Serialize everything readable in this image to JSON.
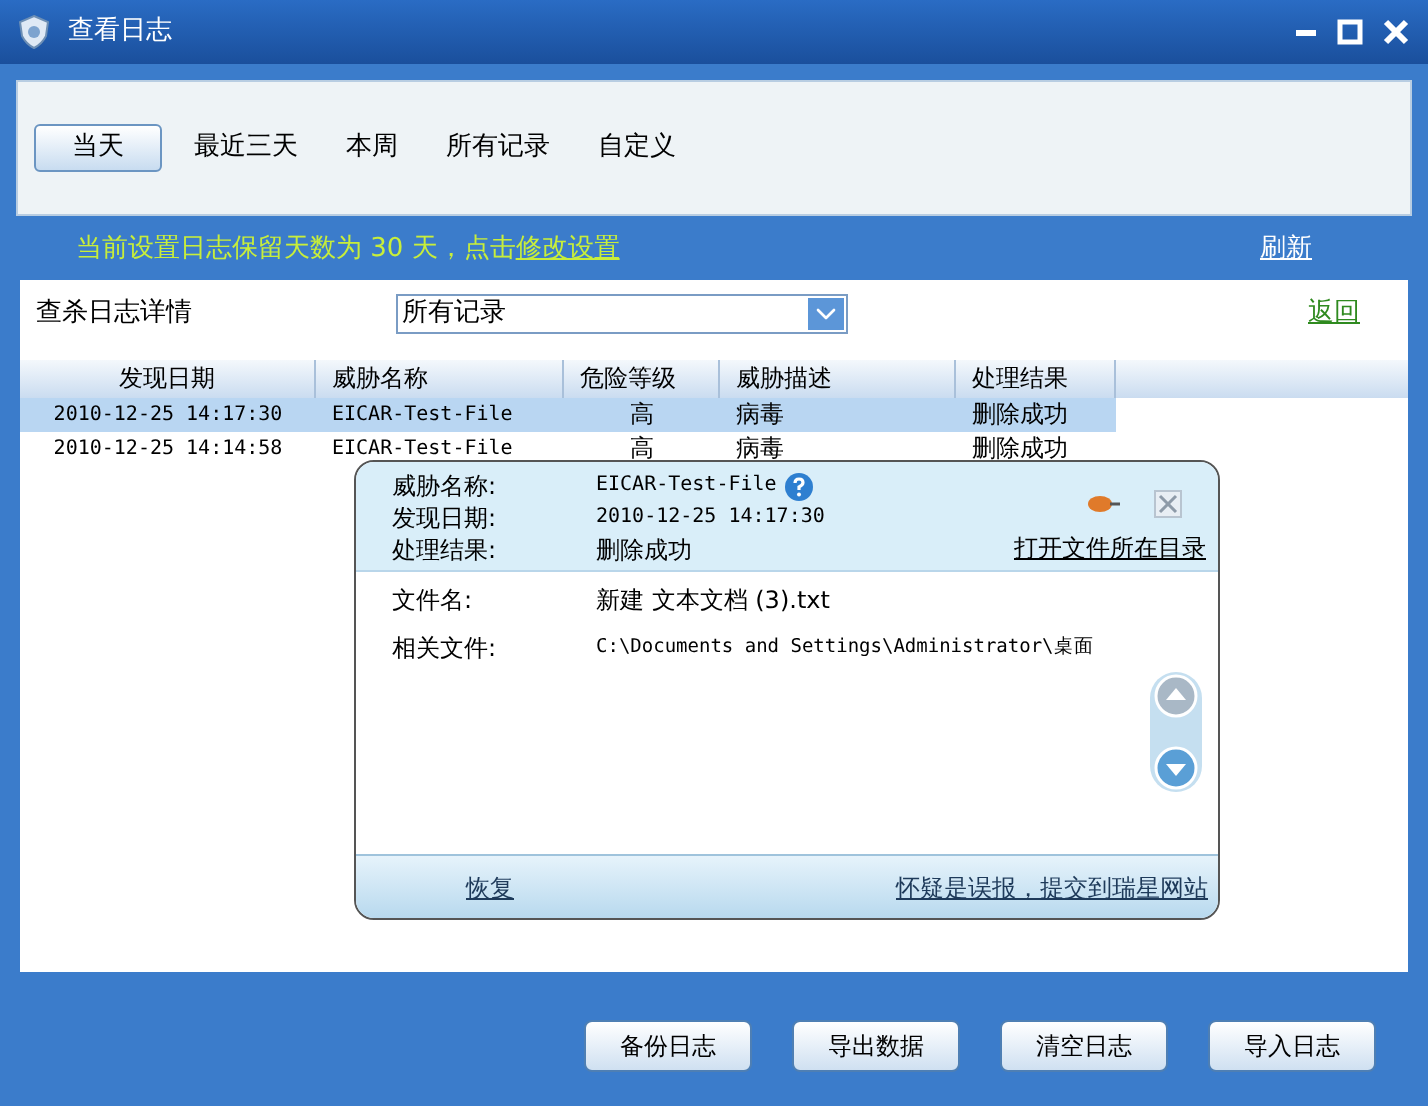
{
  "window": {
    "title": "查看日志"
  },
  "tabs": [
    {
      "label": "当天",
      "selected": true
    },
    {
      "label": "最近三天",
      "selected": false
    },
    {
      "label": "本周",
      "selected": false
    },
    {
      "label": "所有记录",
      "selected": false
    },
    {
      "label": "自定义",
      "selected": false
    }
  ],
  "notice": {
    "text": "当前设置日志保留天数为 30 天，点击",
    "link": "修改设置"
  },
  "refresh": "刷新",
  "filter": {
    "label": "查杀日志详情",
    "value": "所有记录"
  },
  "back": "返回",
  "table": {
    "columns": [
      "发现日期",
      "威胁名称",
      "危险等级",
      "威胁描述",
      "处理结果"
    ],
    "rows": [
      {
        "cells": [
          "2010-12-25 14:17:30",
          "EICAR-Test-File",
          "高",
          "病毒",
          "删除成功"
        ],
        "selected": true
      },
      {
        "cells": [
          "2010-12-25 14:14:58",
          "EICAR-Test-File",
          "高",
          "病毒",
          "删除成功"
        ],
        "selected": false
      }
    ]
  },
  "popup": {
    "fields": [
      {
        "label": "威胁名称:",
        "value": "EICAR-Test-File"
      },
      {
        "label": "发现日期:",
        "value": "2010-12-25 14:17:30"
      },
      {
        "label": "处理结果:",
        "value": "删除成功"
      }
    ],
    "open_folder": "打开文件所在目录",
    "details": [
      {
        "label": "文件名:",
        "value": "新建 文本文档 (3).txt"
      },
      {
        "label": "相关文件:",
        "value": "C:\\Documents and Settings\\Administrator\\桌面"
      }
    ],
    "restore": "恢复",
    "report": "怀疑是误报，提交到瑞星网站"
  },
  "buttons": [
    "备份日志",
    "导出数据",
    "清空日志",
    "导入日志"
  ]
}
